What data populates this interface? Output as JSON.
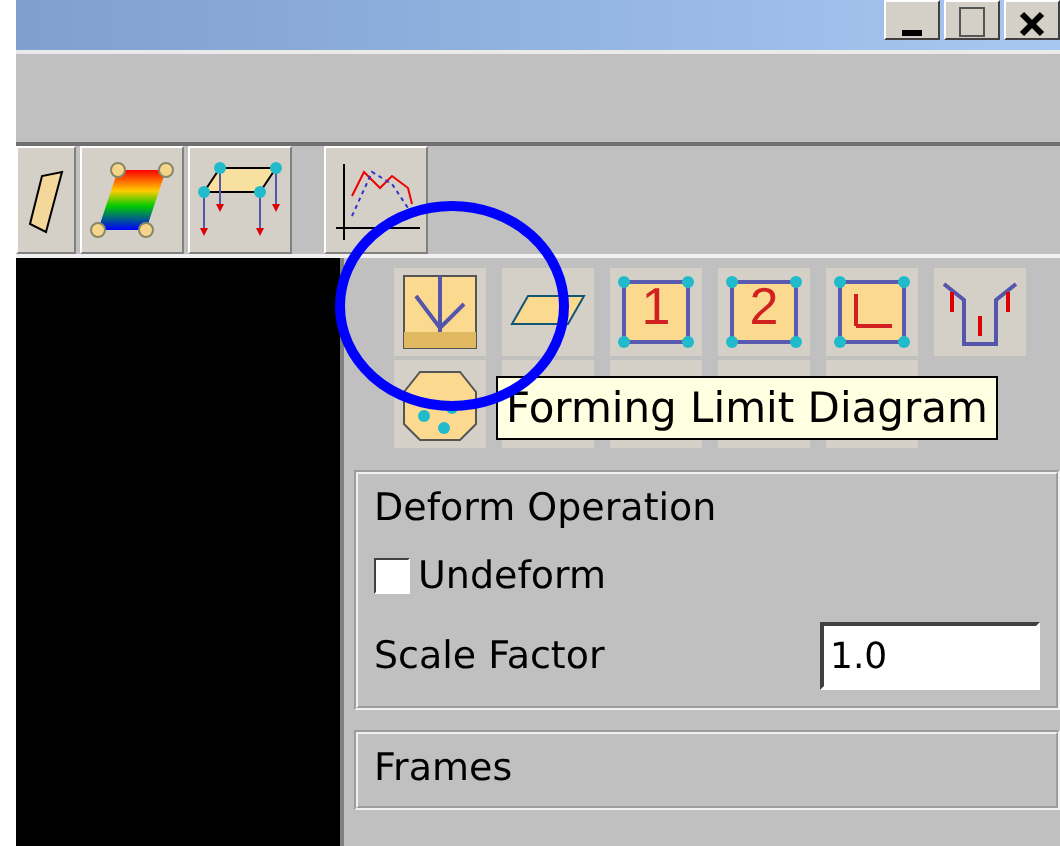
{
  "numbered_buttons": [
    {
      "label": "1"
    },
    {
      "label": "2"
    }
  ],
  "tooltip": {
    "text": "Forming Limit Diagram"
  },
  "deform_operation": {
    "title": "Deform Operation",
    "undeform": {
      "label": "Undeform",
      "checked": false
    },
    "scale_factor": {
      "label": "Scale Factor",
      "value": "1.0"
    }
  },
  "frames": {
    "title": "Frames"
  }
}
